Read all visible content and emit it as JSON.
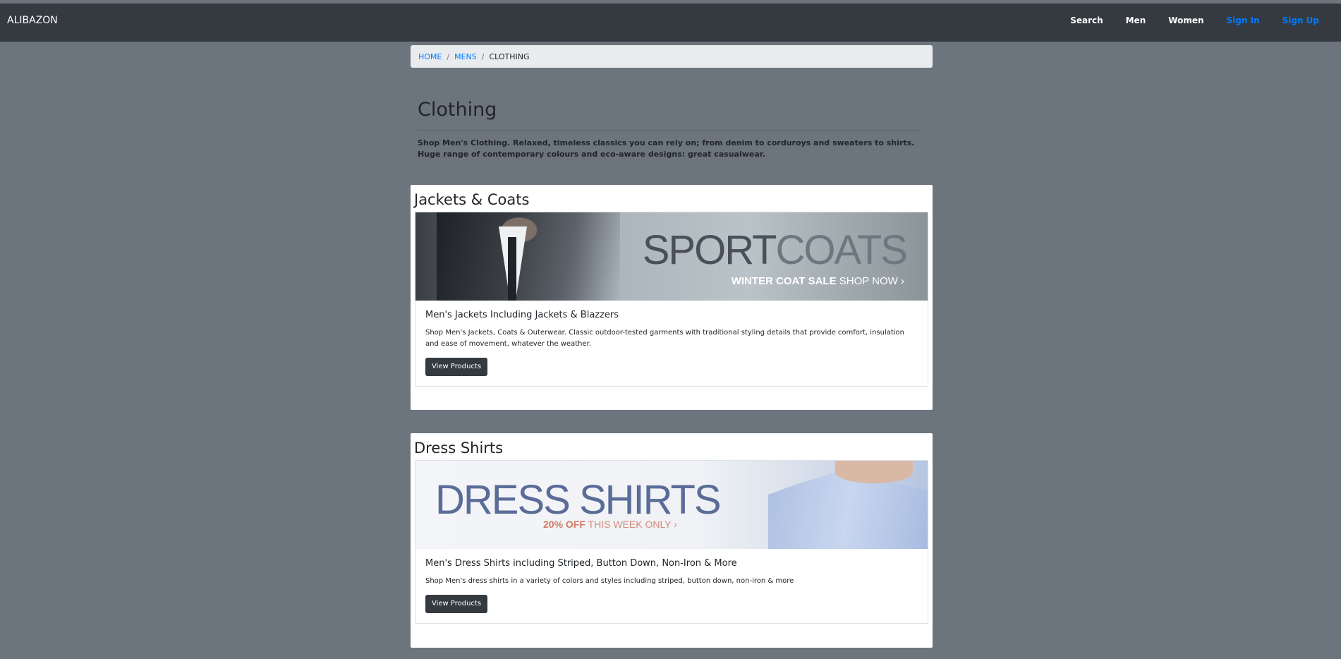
{
  "navbar": {
    "brand": "ALIBAZON",
    "links": [
      {
        "label": "Search"
      },
      {
        "label": "Men"
      },
      {
        "label": "Women"
      },
      {
        "label": "Sign In"
      },
      {
        "label": "Sign Up"
      }
    ]
  },
  "breadcrumb": {
    "items": [
      "HOME",
      "MENS",
      "CLOTHING"
    ],
    "separator": "/"
  },
  "intro": {
    "title": "Clothing",
    "description": "Shop Men's Clothing. Relaxed, timeless classics you can rely on; from denim to corduroys and sweaters to shirts. Huge range of contemporary colours and eco-aware designs: great casualwear."
  },
  "sections": [
    {
      "heading": "Jackets & Coats",
      "banner": {
        "title_a": "SPORT",
        "title_b": "COATS",
        "sub_bold": "WINTER COAT SALE",
        "sub_rest": " SHOP NOW ›"
      },
      "card_title": "Men's Jackets Including Jackets & Blazzers",
      "card_text": "Shop Men's Jackets, Coats & Outerwear. Classic outdoor-tested garments with traditional styling details that provide comfort, insulation and ease of movement, whatever the weather.",
      "button_label": "View Products"
    },
    {
      "heading": "Dress Shirts",
      "banner": {
        "title": "DRESS SHIRTS",
        "sub_bold": "20% OFF",
        "sub_rest": " THIS WEEK ONLY ›"
      },
      "card_title": "Men's Dress Shirts including Striped, Button Down, Non-Iron & More",
      "card_text": "Shop Men's dress shirts in a variety of colors and styles including striped, button down, non-iron & more",
      "button_label": "View Products"
    }
  ],
  "colors": {
    "page_bg": "#6c757d",
    "navbar_bg": "#343a40",
    "link_blue": "#007bff",
    "breadcrumb_bg": "#e9ecef",
    "button_bg": "#343a40"
  }
}
